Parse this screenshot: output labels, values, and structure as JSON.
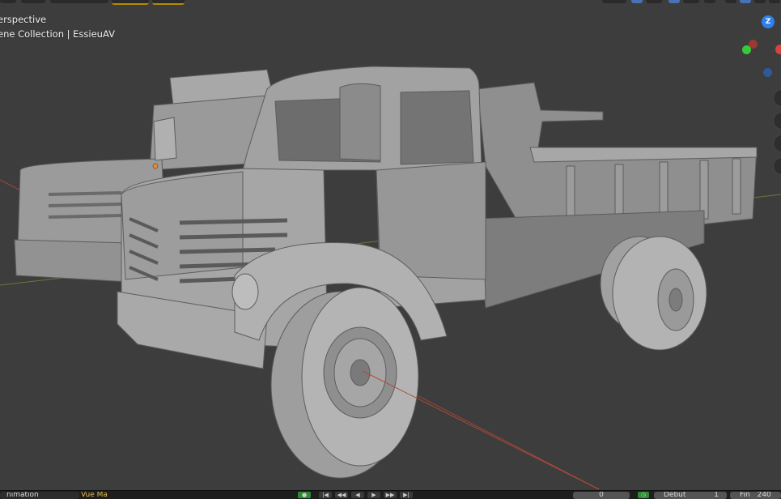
{
  "viewport": {
    "view_mode": "erspective",
    "collection": "ene Collection | EssieuAV"
  },
  "gizmo": {
    "z_label": "Z"
  },
  "colors": {
    "background": "#3d3d3d",
    "gizmo_z": "#2f80ed",
    "gizmo_y": "#7ab02c",
    "gizmo_x": "#d6453c",
    "model": "#9a9a9a"
  },
  "icons": [
    "cursor-icon",
    "grid-icon",
    "shading-solid-icon",
    "hand-icon",
    "zoom-icon",
    "camera-icon"
  ],
  "timeline": {
    "editor_type": "nimation",
    "menu": "Vue  Ma",
    "current_frame": "0",
    "start_label": "Début",
    "start_value": "1",
    "end_label": "Fin",
    "end_value": "240"
  }
}
